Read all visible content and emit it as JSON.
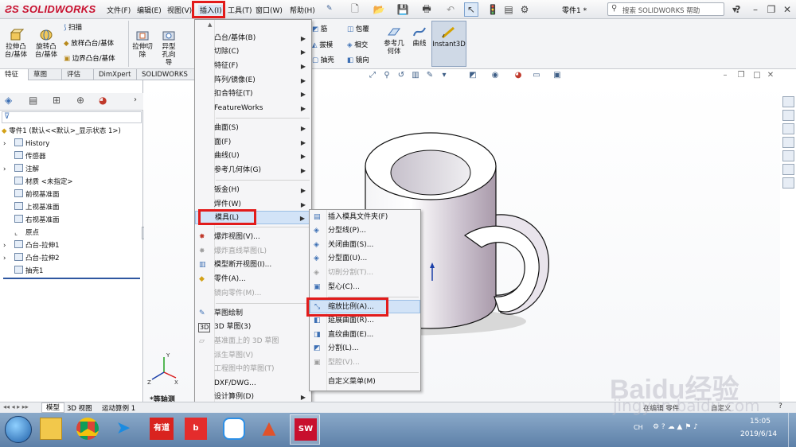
{
  "app": {
    "logo": "SOLIDWORKS",
    "document_title": "零件1 *",
    "search_placeholder": "搜索 SOLIDWORKS 帮助"
  },
  "menubar": [
    {
      "label": "文件(F)"
    },
    {
      "label": "编辑(E)"
    },
    {
      "label": "视图(V)"
    },
    {
      "label": "插入(I)"
    },
    {
      "label": "工具(T)"
    },
    {
      "label": "窗口(W)"
    },
    {
      "label": "帮助(H)"
    }
  ],
  "commands": {
    "extrude": "拉伸凸台/基体",
    "revolve": "旋转凸台/基体",
    "sweep": "扫描",
    "loft": "放样凸台/基体",
    "boundary": "边界凸台/基体",
    "extrude_cut": "拉伸切除",
    "hole_wizard": "异型孔向导",
    "rib": "筋",
    "wrap": "包覆",
    "draft": "拔模",
    "intersect": "相交",
    "shell": "抽壳",
    "mirror": "镜向",
    "ref_geometry": "参考几何体",
    "curves": "曲线",
    "instant3d": "Instant3D"
  },
  "tabs": [
    "特征",
    "草图",
    "评估",
    "DimXpert",
    "SOLIDWORKS 插件"
  ],
  "tree": {
    "root": "零件1 (默认<<默认>_显示状态 1>)",
    "items": [
      {
        "label": "History",
        "arrow": true
      },
      {
        "label": "传感器",
        "arrow": false
      },
      {
        "label": "注解",
        "arrow": true
      },
      {
        "label": "材质 <未指定>",
        "arrow": false
      },
      {
        "label": "前视基准面",
        "arrow": false
      },
      {
        "label": "上视基准面",
        "arrow": false
      },
      {
        "label": "右视基准面",
        "arrow": false
      },
      {
        "label": "原点",
        "arrow": false
      },
      {
        "label": "凸台-拉伸1",
        "arrow": true
      },
      {
        "label": "凸台-拉伸2",
        "arrow": true
      },
      {
        "label": "抽壳1",
        "arrow": false
      }
    ]
  },
  "view_label": "*等轴测",
  "bottom_tabs": [
    "模型",
    "3D 视图",
    "运动算例 1"
  ],
  "insert_menu": {
    "items": [
      {
        "label": "凸台/基体(B)",
        "arrow": true
      },
      {
        "label": "切除(C)",
        "arrow": true
      },
      {
        "label": "特征(F)",
        "arrow": true
      },
      {
        "label": "阵列/镜像(E)",
        "arrow": true
      },
      {
        "label": "扣合特征(T)",
        "arrow": true
      },
      {
        "label": "FeatureWorks",
        "arrow": true
      },
      {
        "label": "曲面(S)",
        "arrow": true
      },
      {
        "label": "面(F)",
        "arrow": true
      },
      {
        "label": "曲线(U)",
        "arrow": true
      },
      {
        "label": "参考几何体(G)",
        "arrow": true
      },
      {
        "label": "钣金(H)",
        "arrow": true
      },
      {
        "label": "焊件(W)",
        "arrow": true
      },
      {
        "label": "模具(L)",
        "arrow": true
      },
      {
        "label": "爆炸视图(V)...",
        "arrow": false
      },
      {
        "label": "爆炸直线草图(L)",
        "arrow": false,
        "disabled": true
      },
      {
        "label": "模型断开视图(I)...",
        "arrow": false
      },
      {
        "label": "零件(A)...",
        "arrow": false
      },
      {
        "label": "镜向零件(M)...",
        "arrow": false,
        "disabled": true
      },
      {
        "label": "草图绘制",
        "arrow": false
      },
      {
        "label": "3D 草图(3)",
        "arrow": false
      },
      {
        "label": "基准面上的 3D 草图",
        "arrow": false,
        "disabled": true
      },
      {
        "label": "派生草图(V)",
        "arrow": false,
        "disabled": true
      },
      {
        "label": "工程图中的草图(T)",
        "arrow": false,
        "disabled": true
      },
      {
        "label": "DXF/DWG...",
        "arrow": false
      },
      {
        "label": "设计算例(D)",
        "arrow": true
      }
    ]
  },
  "mold_menu": {
    "items": [
      {
        "label": "插入模具文件夹(F)"
      },
      {
        "label": "分型线(P)..."
      },
      {
        "label": "关闭曲面(S)..."
      },
      {
        "label": "分型面(U)..."
      },
      {
        "label": "切削分割(T)...",
        "disabled": true
      },
      {
        "label": "型心(C)..."
      },
      {
        "label": "缩放比例(A)..."
      },
      {
        "label": "延展曲面(R)..."
      },
      {
        "label": "直纹曲面(E)..."
      },
      {
        "label": "分割(L)..."
      },
      {
        "label": "型腔(V)...",
        "disabled": true
      },
      {
        "label": "自定义菜单(M)"
      }
    ]
  },
  "status": {
    "editing": "在编辑 零件",
    "custom": "自定义"
  },
  "taskbar": {
    "time": "15:05",
    "date": "2019/6/14",
    "lang": "CH"
  },
  "watermark": {
    "text": "Baidu经验",
    "url": "jingyan.baidu.com"
  },
  "colors": {
    "highlight_red": "#e21b1b",
    "logo_red": "#c8102e"
  }
}
